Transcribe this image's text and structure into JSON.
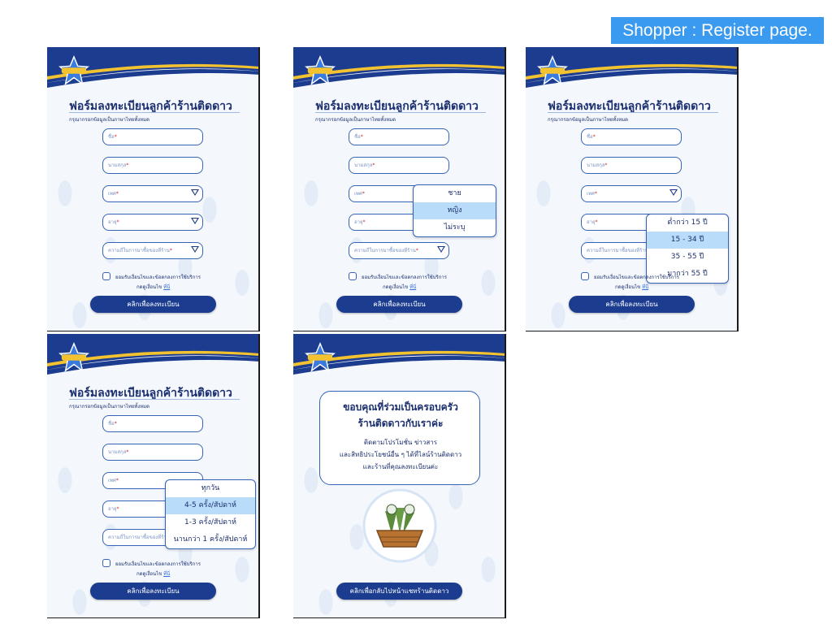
{
  "page_label": "Shopper : Register page.",
  "brand": {
    "logo_text": "ร้านติดดาว"
  },
  "form": {
    "title": "ฟอร์มลงทะเบียนลูกค้าร้านติดดาว",
    "subtitle": "กรุณากรอกข้อมูลเป็นภาษาไทยทั้งหมด",
    "first_name_placeholder": "ชื่อ",
    "last_name_placeholder": "นามสกุล",
    "gender_placeholder": "เพศ",
    "age_placeholder": "อายุ",
    "frequency_placeholder": "ความถี่ในการมาซื้อของที่ร้าน",
    "required_mark": "*",
    "consent_text": "ยอมรับเงื่อนไขและข้อตกลงการใช้บริการ",
    "consent_link_prefix": "กดดูเงื่อนไข",
    "consent_link": "ที่นี่",
    "submit_label": "คลิกเพื่อลงทะเบียน"
  },
  "gender_options": [
    "ชาย",
    "หญิง",
    "ไม่ระบุ"
  ],
  "gender_selected": 1,
  "age_options": [
    "ต่ำกว่า 15 ปี",
    "15 - 34 ปี",
    "35 - 55 ปี",
    "มากว่า 55 ปี"
  ],
  "age_selected": 1,
  "frequency_options": [
    "ทุกวัน",
    "4-5 ครั้ง/สัปดาห์",
    "1-3 ครั้ง/สัปดาห์",
    "นานกว่า 1 ครั้ง/สัปดาห์"
  ],
  "frequency_selected": 1,
  "thanks": {
    "title_line1": "ขอบคุณที่ร่วมเป็นครอบครัว",
    "title_line2": "ร้านติดดาวกับเราค่ะ",
    "body_line1": "ติดตามโปรโมชั่น ข่าวสาร",
    "body_line2": "และสิทธิประโยชน์อื่น ๆ ได้ที่ไลน์ร้านติดดาว",
    "body_line3": "และร้านที่คุณลงทะเบียนค่ะ",
    "back_button": "คลิกเพื่อกลับไปหน้าแชทร้านติดดาว"
  },
  "colors": {
    "navy": "#1c3d8f",
    "accent_blue": "#3a9af0",
    "gold": "#f2c230",
    "selected": "#b9dcfa"
  }
}
